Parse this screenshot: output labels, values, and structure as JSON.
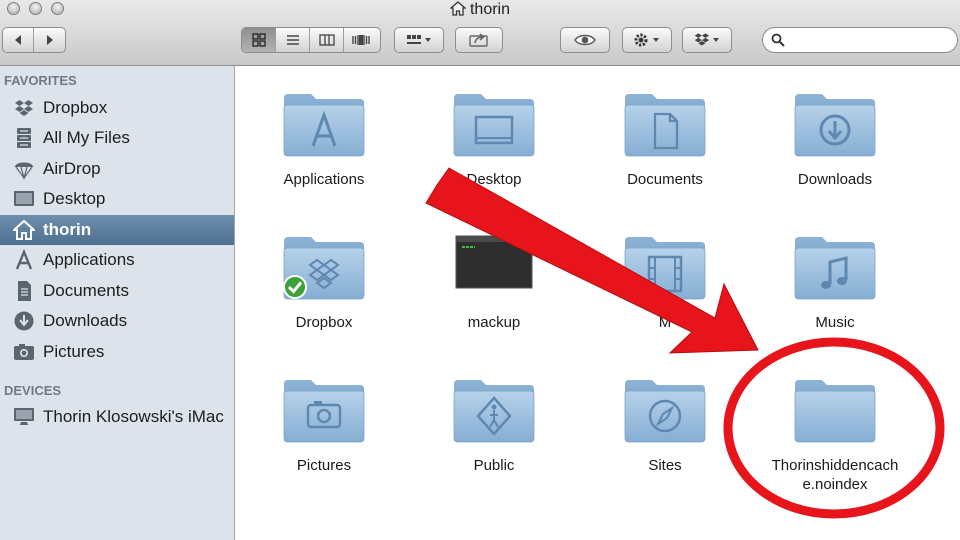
{
  "window": {
    "title": "thorin"
  },
  "sidebar": {
    "favorites_header": "FAVORITES",
    "devices_header": "DEVICES",
    "favorites": [
      {
        "label": "Dropbox",
        "icon": "dropbox-icon"
      },
      {
        "label": "All My Files",
        "icon": "all-files-icon"
      },
      {
        "label": "AirDrop",
        "icon": "airdrop-icon"
      },
      {
        "label": "Desktop",
        "icon": "desktop-icon"
      },
      {
        "label": "thorin",
        "icon": "home-icon",
        "selected": true
      },
      {
        "label": "Applications",
        "icon": "applications-icon"
      },
      {
        "label": "Documents",
        "icon": "documents-icon"
      },
      {
        "label": "Downloads",
        "icon": "downloads-icon"
      },
      {
        "label": "Pictures",
        "icon": "pictures-icon"
      }
    ],
    "devices": [
      {
        "label": "Thorin Klosowski's iMac",
        "icon": "imac-icon"
      }
    ]
  },
  "files": [
    {
      "label": "Applications",
      "icon": "applications-folder-icon"
    },
    {
      "label": "Desktop",
      "icon": "desktop-folder-icon"
    },
    {
      "label": "Documents",
      "icon": "documents-folder-icon"
    },
    {
      "label": "Downloads",
      "icon": "downloads-folder-icon"
    },
    {
      "label": "Dropbox",
      "icon": "dropbox-folder-icon",
      "badge": "synced-check"
    },
    {
      "label": "mackup",
      "icon": "terminal-executable-icon"
    },
    {
      "label": "M",
      "icon": "movies-folder-icon"
    },
    {
      "label": "Music",
      "icon": "music-folder-icon"
    },
    {
      "label": "Pictures",
      "icon": "pictures-folder-icon"
    },
    {
      "label": "Public",
      "icon": "public-folder-icon"
    },
    {
      "label": "Sites",
      "icon": "sites-folder-icon"
    },
    {
      "label": "Thorinshiddencache.noindex",
      "label_line1": "Thorinshiddencach",
      "label_line2": "e.noindex",
      "icon": "plain-folder-icon",
      "highlighted": true
    }
  ],
  "colors": {
    "annotation": "#e8141b",
    "sidebar_bg": "#dde3ea",
    "selection": "#5a7a9a",
    "folder": "#9dbfdc"
  }
}
